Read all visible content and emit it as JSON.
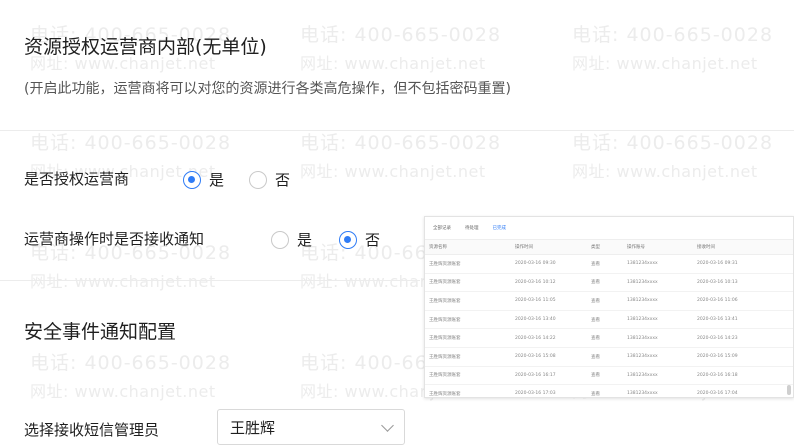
{
  "watermark": {
    "phone": "电话: 400-665-0028",
    "url": "网址: www.chanjet.net"
  },
  "auth": {
    "title": "资源授权运营商内部(无单位)",
    "description": "(开启此功能，运营商将可以对您的资源进行各类高危操作，但不包括密码重置)"
  },
  "authorize_operator": {
    "label": "是否授权运营商",
    "options": [
      "是",
      "否"
    ],
    "selected": "是"
  },
  "receive_notification": {
    "label": "运营商操作时是否接收通知",
    "options": [
      "是",
      "否"
    ],
    "selected": "否"
  },
  "security": {
    "title": "安全事件通知配置",
    "sms_admin_label": "选择接收短信管理员",
    "sms_admin_value": "王胜辉"
  },
  "embedded_screenshot": {
    "tabs": [
      "全部记录",
      "待处理",
      "已完成"
    ],
    "headers": [
      "资源名称",
      "操作时间",
      "类型",
      "操作账号",
      "接收时间"
    ],
    "rows": [
      [
        "王胜辉资源账套",
        "2020-03-16 09:30",
        "查看",
        "1381234xxxx",
        "2020-03-16 09:31"
      ],
      [
        "王胜辉资源账套",
        "2020-03-16 10:12",
        "查看",
        "1381234xxxx",
        "2020-03-16 10:13"
      ],
      [
        "王胜辉资源账套",
        "2020-03-16 11:05",
        "查看",
        "1381234xxxx",
        "2020-03-16 11:06"
      ],
      [
        "王胜辉资源账套",
        "2020-03-16 13:40",
        "查看",
        "1381234xxxx",
        "2020-03-16 13:41"
      ],
      [
        "王胜辉资源账套",
        "2020-03-16 14:22",
        "查看",
        "1381234xxxx",
        "2020-03-16 14:23"
      ],
      [
        "王胜辉资源账套",
        "2020-03-16 15:08",
        "查看",
        "1381234xxxx",
        "2020-03-16 15:09"
      ],
      [
        "王胜辉资源账套",
        "2020-03-16 16:17",
        "查看",
        "1381234xxxx",
        "2020-03-16 16:18"
      ],
      [
        "王胜辉资源账套",
        "2020-03-16 17:03",
        "查看",
        "1381234xxxx",
        "2020-03-16 17:04"
      ]
    ]
  }
}
